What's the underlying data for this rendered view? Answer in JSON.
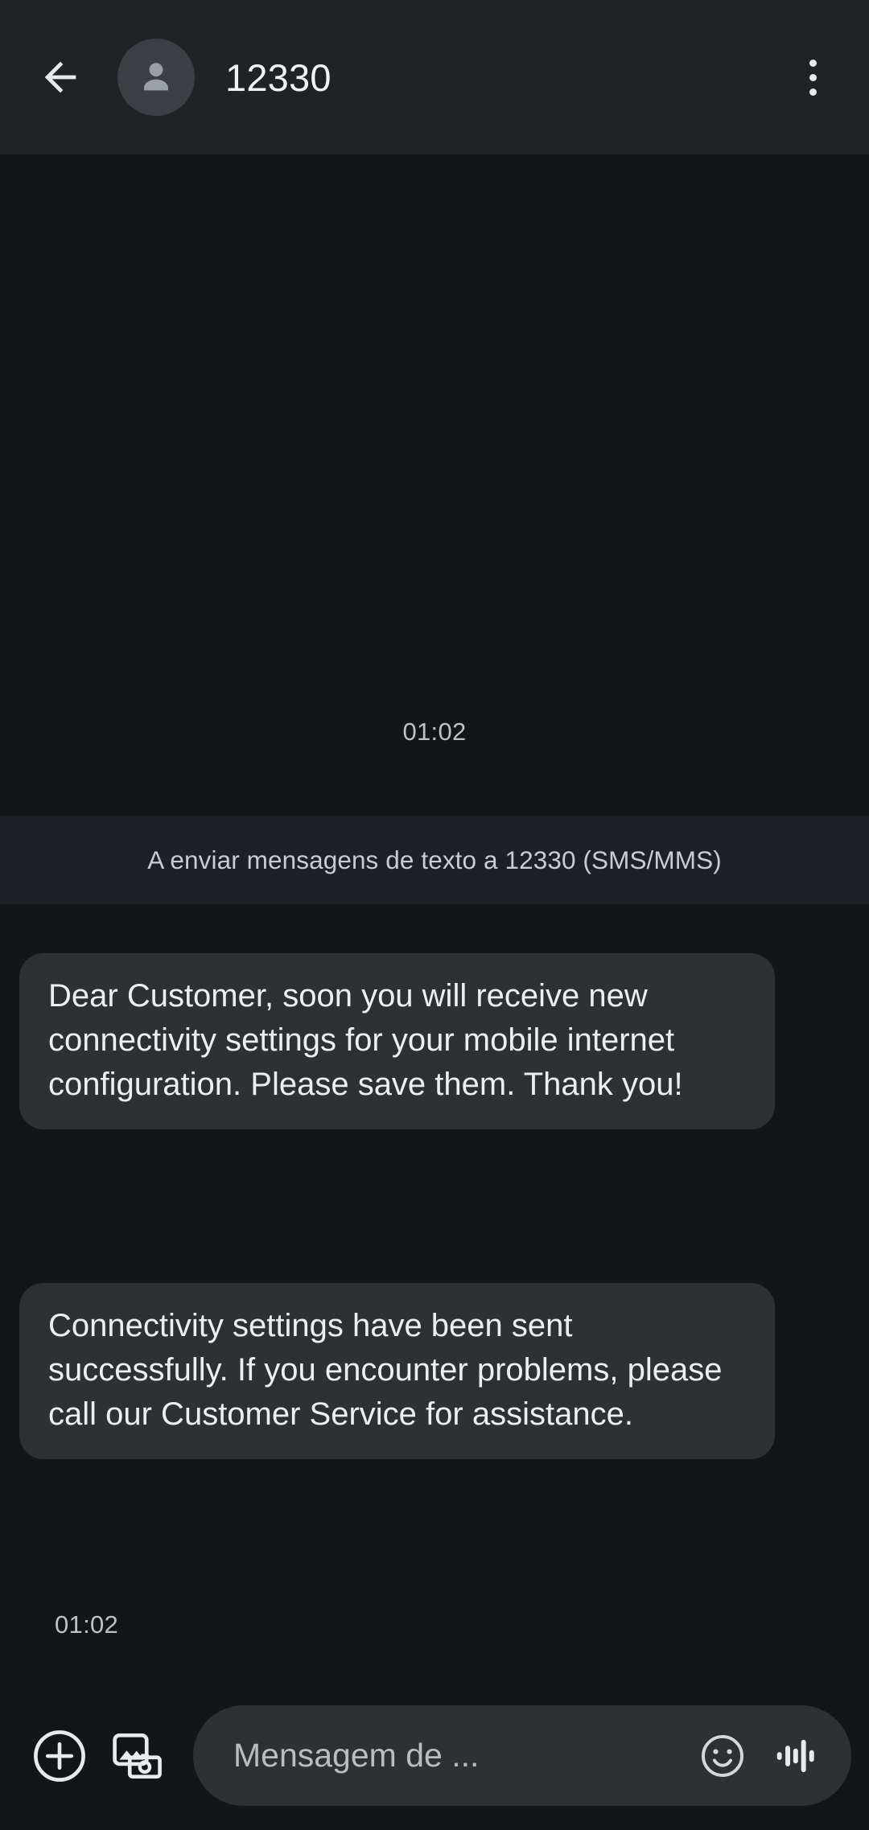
{
  "appbar": {
    "back_icon": "arrow-left-icon",
    "avatar_icon": "person-avatar-icon",
    "title": "12330",
    "overflow_icon": "more-vert-icon"
  },
  "thread": {
    "day_time": "01:02",
    "sending_banner": "A enviar mensagens de texto a 12330 (SMS/MMS)",
    "messages": [
      {
        "text": "Dear Customer, soon you will receive new connectivity settings for your mobile internet configuration. Please save them. Thank you!",
        "side": "incoming"
      },
      {
        "text": "Connectivity settings have been sent successfully. If you encounter problems, please call our  Customer Service for assistance.",
        "side": "incoming"
      }
    ],
    "message_time": "01:02"
  },
  "composer": {
    "plus_icon": "plus-circle-icon",
    "gallery_icon": "gallery-camera-icon",
    "placeholder": "Mensagem de ...",
    "emoji_icon": "smiley-face-icon",
    "audio_icon": "audio-waveform-icon"
  },
  "colors": {
    "appbar_bg": "#202226",
    "thread_bg": "#131619",
    "banner_bg": "#1d2024",
    "bubble_bg": "#2e3134",
    "bubble_text": "#eceff1",
    "secondary_text": "#bdc1c6",
    "icon": "#e8eaed"
  }
}
